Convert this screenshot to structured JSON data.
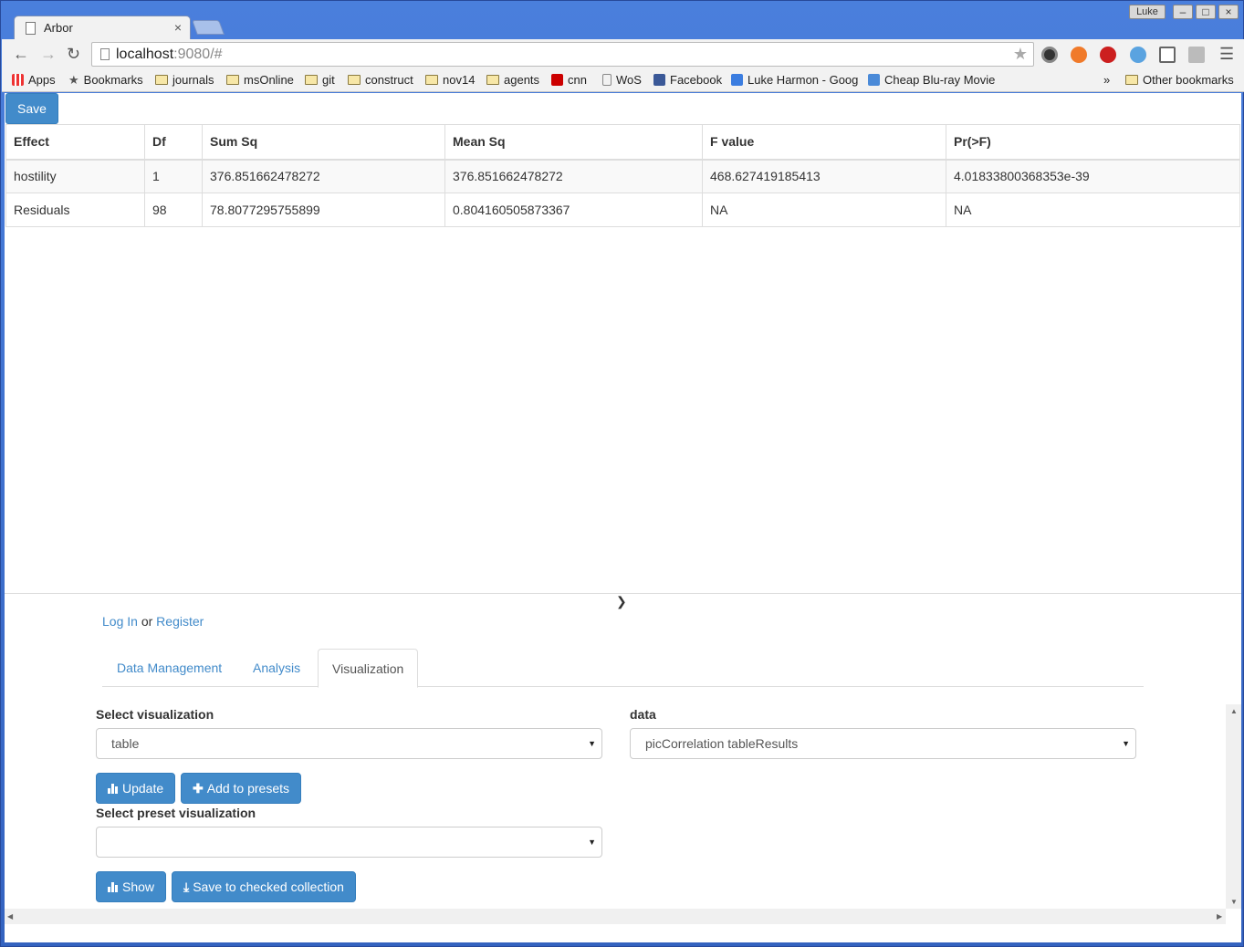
{
  "browser": {
    "tab_title": "Arbor",
    "tab_close": "×",
    "user_name": "Luke",
    "win_min": "–",
    "win_max": "□",
    "win_close": "×",
    "url_host": "localhost",
    "url_rest": ":9080/#",
    "bookmarks": [
      "Apps",
      "Bookmarks",
      "journals",
      "msOnline",
      "git",
      "construct",
      "nov14",
      "agents",
      "cnn",
      "WoS",
      "Facebook",
      "Luke Harmon - Googl",
      "Cheap Blu-ray Movie"
    ],
    "bookmarks_overflow": "»",
    "other_bookmarks": "Other bookmarks"
  },
  "toolbar": {
    "save_label": "Save"
  },
  "table": {
    "headers": [
      "Effect",
      "Df",
      "Sum Sq",
      "Mean Sq",
      "F value",
      "Pr(>F)"
    ],
    "rows": [
      [
        "hostility",
        "1",
        "376.851662478272",
        "376.851662478272",
        "468.627419185413",
        "4.01833800368353e-39"
      ],
      [
        "Residuals",
        "98",
        "78.8077295755899",
        "0.804160505873367",
        "NA",
        "NA"
      ]
    ]
  },
  "auth": {
    "login": "Log In",
    "or": "or",
    "register": "Register"
  },
  "tabs": [
    "Data Management",
    "Analysis",
    "Visualization"
  ],
  "viz": {
    "select_label": "Select visualization",
    "select_value": "table",
    "data_label": "data",
    "data_value": "picCorrelation tableResults",
    "update_label": "Update",
    "add_presets_label": "Add to presets",
    "preset_label": "Select preset visualization",
    "preset_value": "",
    "show_label": "Show",
    "save_collection_label": "Save to checked collection"
  },
  "colors": {
    "primary": "#428bca",
    "chrome_frame": "#3b6cc8"
  }
}
